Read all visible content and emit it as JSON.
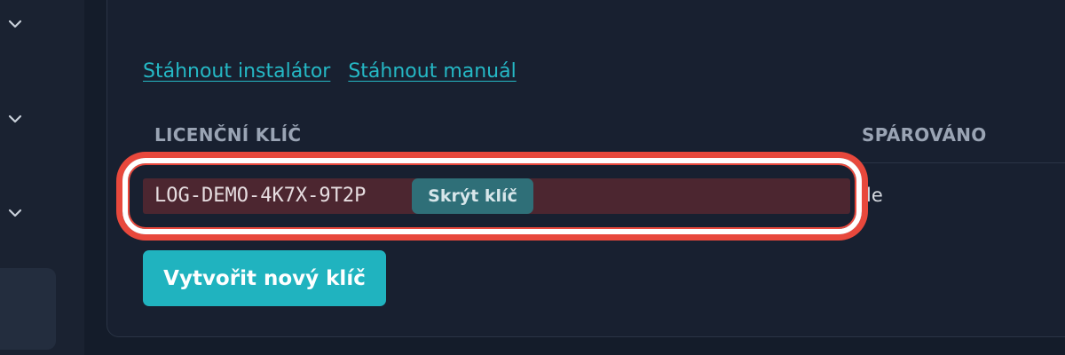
{
  "sidebar": {
    "chevrons": [
      "chevron-down-icon",
      "chevron-down-icon",
      "chevron-down-icon"
    ]
  },
  "links": {
    "download_installer": "Stáhnout instalátor",
    "download_manual": "Stáhnout manuál"
  },
  "table": {
    "headers": {
      "license_key": "LICENČNÍ KLÍČ",
      "paired": "SPÁROVÁNO"
    },
    "rows": [
      {
        "license_key": "LOG-DEMO-4K7X-9T2P",
        "hide_key_label": "Skrýt klíč",
        "paired": "le"
      }
    ]
  },
  "actions": {
    "create_new_key": "Vytvořit nový klíč"
  },
  "colors": {
    "accent": "#20b3bf",
    "highlight_ring": "#e8483c",
    "key_cell_bg": "#4c2630"
  }
}
